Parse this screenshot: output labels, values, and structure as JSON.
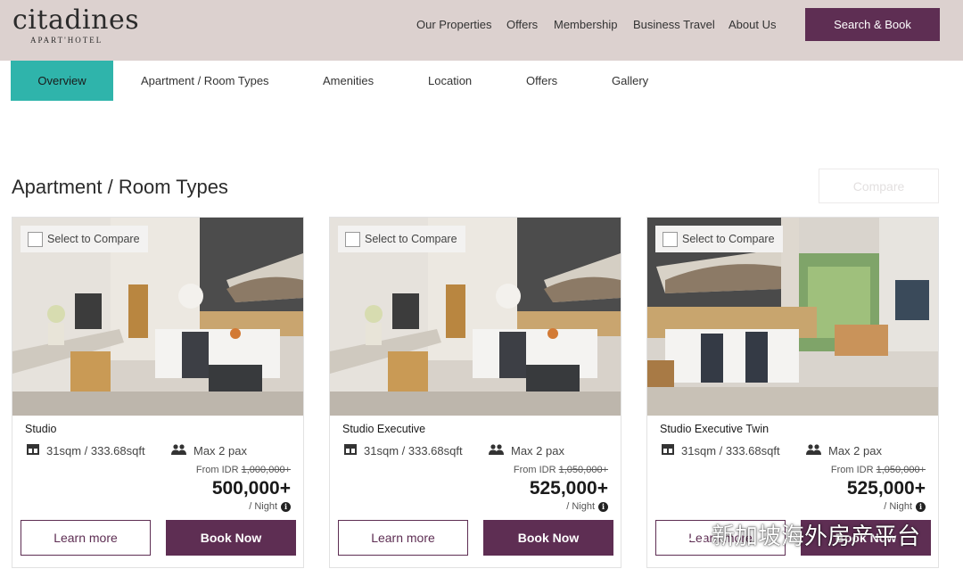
{
  "header": {
    "logo_main": "citadines",
    "logo_sub": "APART'HOTEL",
    "nav": [
      "Our Properties",
      "Offers",
      "Membership",
      "Business Travel",
      "About Us"
    ],
    "cta": "Search & Book"
  },
  "tabs": [
    "Overview",
    "Apartment / Room Types",
    "Amenities",
    "Location",
    "Offers",
    "Gallery"
  ],
  "active_tab": "Overview",
  "section": {
    "title": "Apartment / Room Types",
    "compare": "Compare"
  },
  "cards": [
    {
      "select_label": "Select to Compare",
      "name": "Studio",
      "size": "31sqm / 333.68sqft",
      "pax": "Max 2 pax",
      "from_label": "From IDR",
      "old_price": "1,000,000+",
      "price": "500,000+",
      "per_night": "/ Night",
      "learn": "Learn more",
      "book": "Book Now"
    },
    {
      "select_label": "Select to Compare",
      "name": "Studio Executive",
      "size": "31sqm / 333.68sqft",
      "pax": "Max 2 pax",
      "from_label": "From IDR",
      "old_price": "1,050,000+",
      "price": "525,000+",
      "per_night": "/ Night",
      "learn": "Learn more",
      "book": "Book Now"
    },
    {
      "select_label": "Select to Compare",
      "name": "Studio Executive Twin",
      "size": "31sqm / 333.68sqft",
      "pax": "Max 2 pax",
      "from_label": "From IDR",
      "old_price": "1,050,000+",
      "price": "525,000+",
      "per_night": "/ Night",
      "learn": "Learn more",
      "book": "Book Now"
    }
  ],
  "watermark": "新加坡海外房产平台",
  "icons": {
    "size": "floorplan-icon",
    "pax": "people-icon",
    "info": "info-icon",
    "watermark": "wechat-icon"
  },
  "colors": {
    "brand_purple": "#5e2e53",
    "active_tab": "#2fb4ab",
    "header_bg": "#dcd1cf"
  }
}
